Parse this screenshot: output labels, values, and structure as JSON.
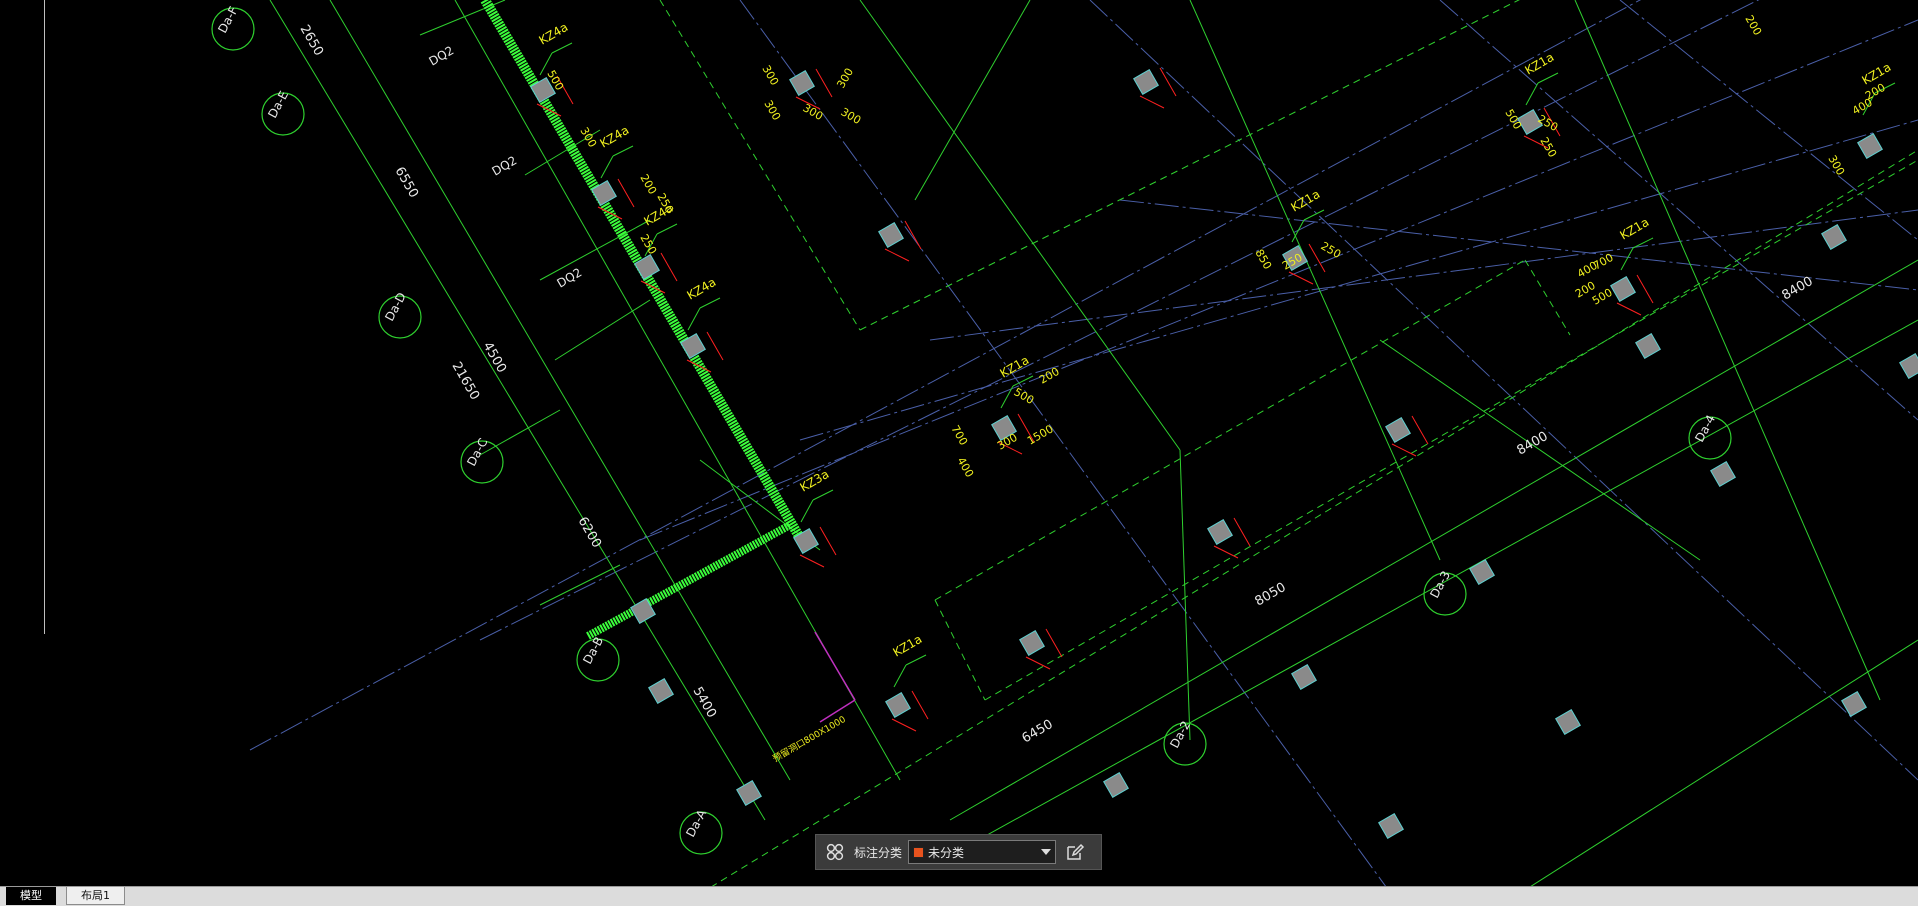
{
  "drawing": {
    "axes": [
      "Da-F",
      "Da-E",
      "Da-D",
      "Da-C",
      "Da-B",
      "Da-A",
      "Da-2",
      "Da-3",
      "Da-4"
    ],
    "column_tags": [
      "KZ4a",
      "KZ4a",
      "KZ4a",
      "KZ4a",
      "KZ3a",
      "KZ1a",
      "KZ1a",
      "KZ1a",
      "KZ1a",
      "KZ1a",
      "KZ1a"
    ],
    "beam_tags": [
      "DQ2",
      "DQ2",
      "DQ2"
    ],
    "dimensions": [
      "2650",
      "6550",
      "4500",
      "21650",
      "6200",
      "5400",
      "6450",
      "8050",
      "8400",
      "8400"
    ],
    "small_dims": [
      "300",
      "300",
      "300",
      "300",
      "300",
      "500",
      "300",
      "200",
      "250",
      "250",
      "500",
      "200",
      "850",
      "250",
      "250",
      "250",
      "500",
      "250",
      "200",
      "500",
      "400",
      "700",
      "400",
      "200",
      "300",
      "200",
      "700",
      "400",
      "300",
      "1500"
    ],
    "note_text": "预留洞口800X1000"
  },
  "toolbar": {
    "label": "标注分类",
    "category_value": "未分类",
    "category_color": "#e8531e"
  },
  "tabs": {
    "model": "模型",
    "layout1": "布局1"
  },
  "colors": {
    "background": "#000000",
    "grid_green": "#2fd02f",
    "axis_blue": "#4a5fa8",
    "dim_red": "#ff2020",
    "text_yellow": "#f0f020",
    "wall_green": "#3cff3c",
    "column_gray": "#8a8a8a",
    "note_magenta": "#c02fc0"
  }
}
